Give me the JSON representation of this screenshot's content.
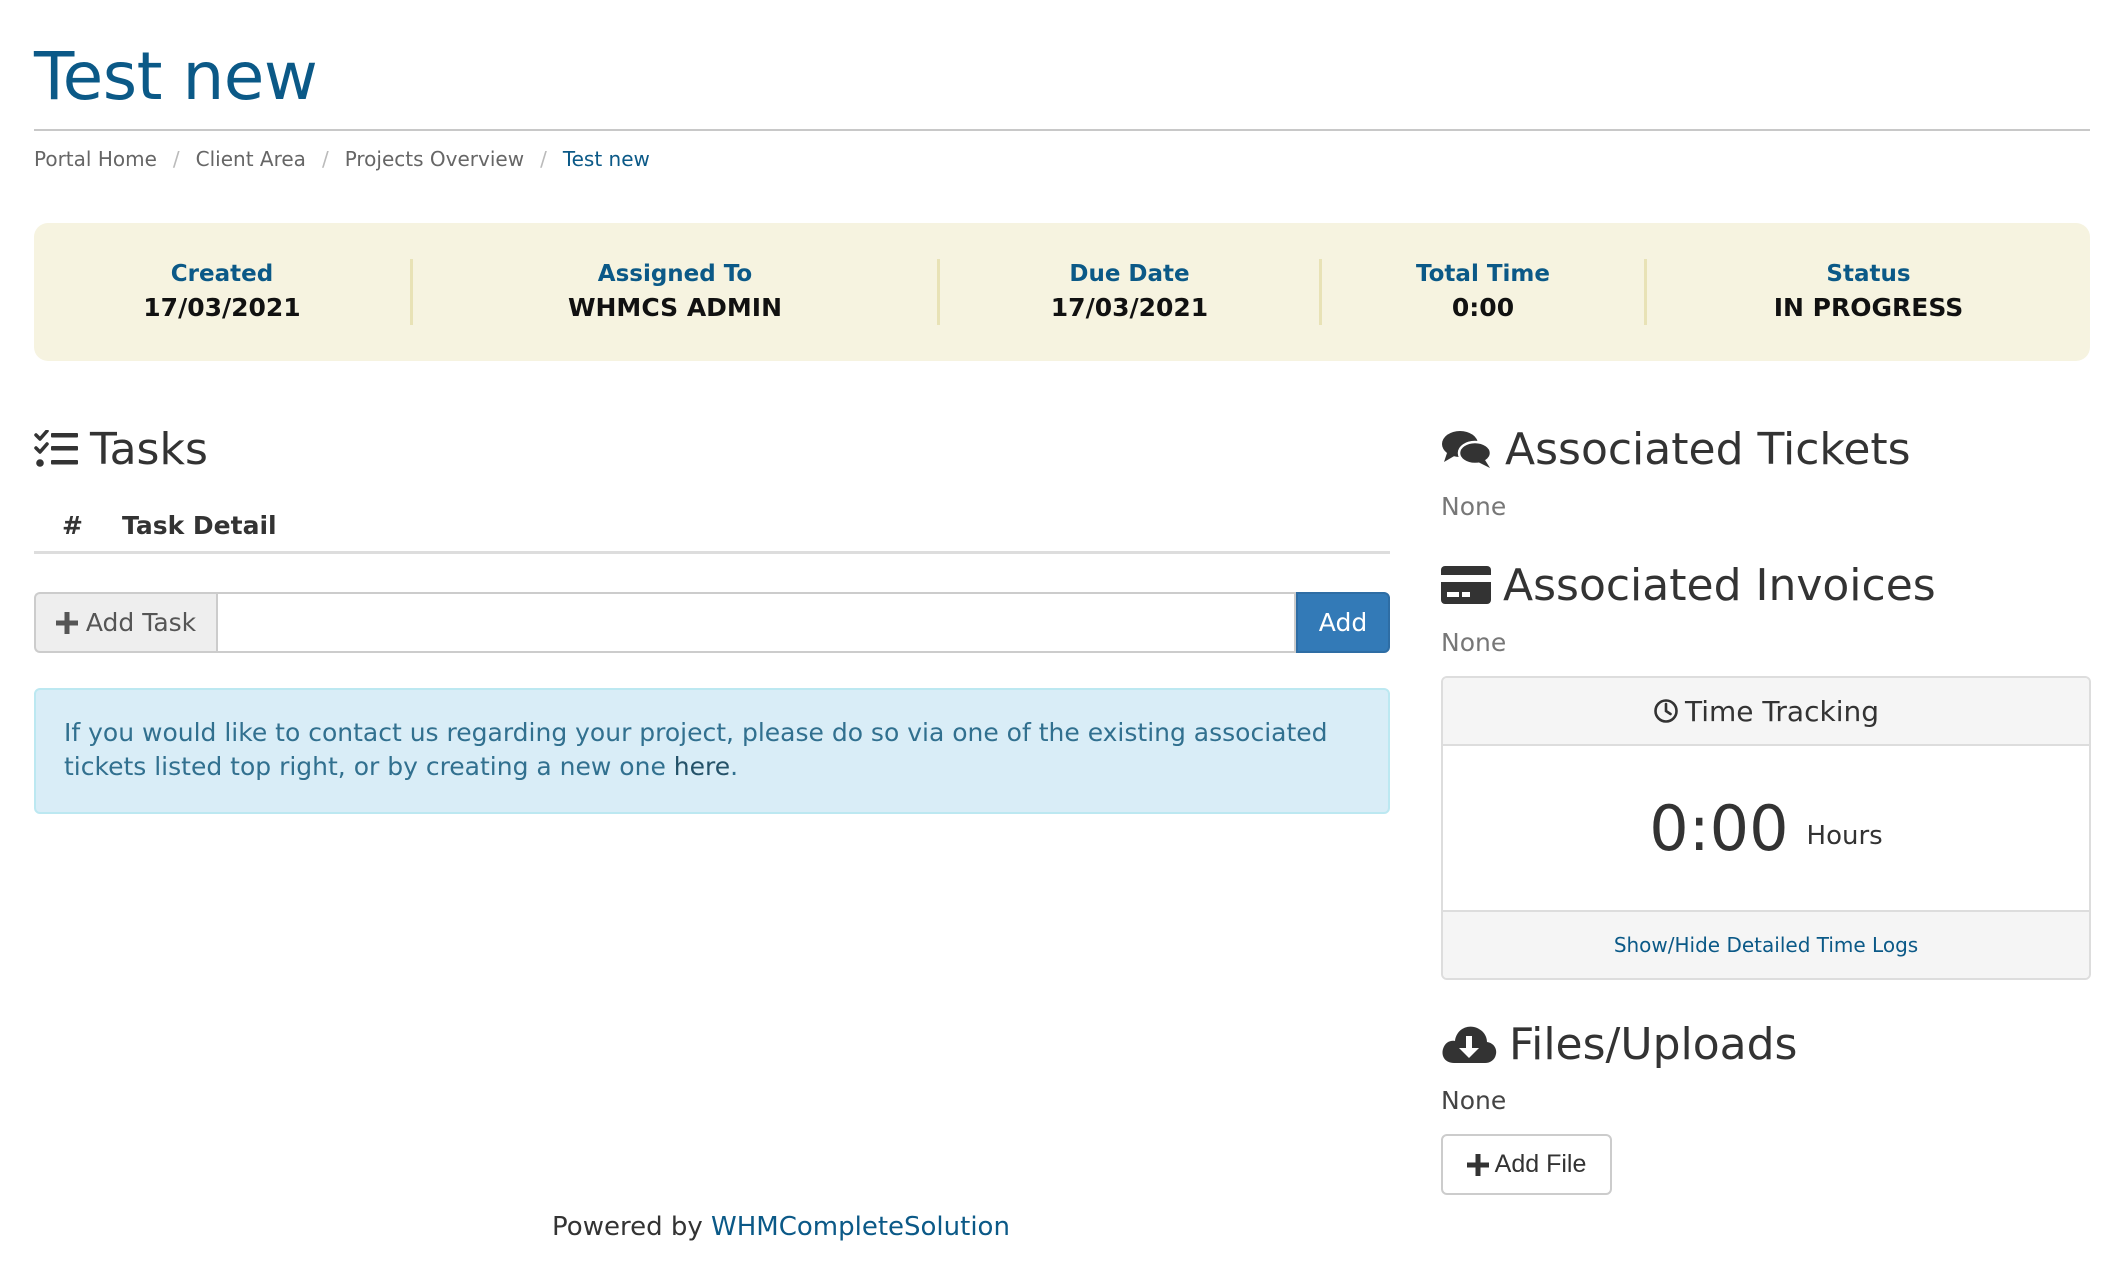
{
  "page": {
    "title": "Test new"
  },
  "breadcrumb": [
    "Portal Home",
    "Client Area",
    "Projects Overview",
    "Test new"
  ],
  "summary": [
    {
      "label": "Created",
      "value": "17/03/2021"
    },
    {
      "label": "Assigned To",
      "value": "WHMCS ADMIN"
    },
    {
      "label": "Due Date",
      "value": "17/03/2021"
    },
    {
      "label": "Total Time",
      "value": "0:00"
    },
    {
      "label": "Status",
      "value": "IN PROGRESS"
    }
  ],
  "tasks": {
    "heading": "Tasks",
    "columns": [
      "#",
      "Task Detail"
    ],
    "add_addon_label": "Add Task",
    "input_value": "",
    "add_button_label": "Add"
  },
  "alert": {
    "text": "If you would like to contact us regarding your project, please do so via one of the existing associated tickets listed top right, or by creating a new one ",
    "link_text": "here",
    "suffix": "."
  },
  "tickets": {
    "heading": "Associated Tickets",
    "empty": "None"
  },
  "invoices": {
    "heading": "Associated Invoices",
    "empty": "None"
  },
  "time_tracking": {
    "heading": "Time Tracking",
    "value": "0:00",
    "unit": "Hours",
    "toggle_link": "Show/Hide Detailed Time Logs"
  },
  "files": {
    "heading": "Files/Uploads",
    "empty": "None",
    "add_button_label": "Add File"
  },
  "footer": {
    "prefix": "Powered by ",
    "link": "WHMCompleteSolution"
  },
  "colors": {
    "accent": "#0b5987",
    "primary_button": "#337ab7",
    "summary_bg": "#f6f3e0",
    "alert_bg": "#d9edf7"
  },
  "icons": {
    "tasks": "tasks-list-icon",
    "tickets": "comments-icon",
    "invoices": "credit-card-icon",
    "time": "clock-icon",
    "files": "cloud-download-icon",
    "plus": "plus-icon"
  }
}
